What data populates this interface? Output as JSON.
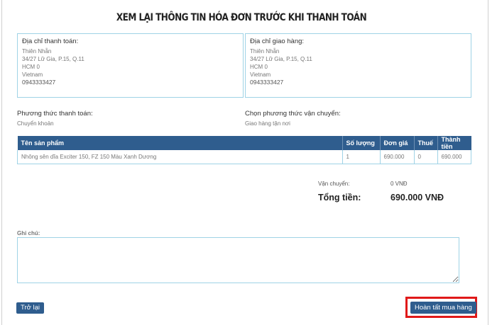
{
  "page": {
    "title": "XEM LẠI THÔNG TIN HÓA ĐƠN TRƯỚC KHI THANH TOÁN",
    "accent_color": "#2f5d8e",
    "border_color": "#9fd3e6",
    "highlight_color": "#e01919"
  },
  "billing_address": {
    "heading": "Địa chỉ thanh toán:",
    "name": "Thiên Nhẫn",
    "street": "34/27 Lữ Gia, P.15, Q.11",
    "city": "HCM 0",
    "country": "Vietnam",
    "phone": "0943333427"
  },
  "shipping_address": {
    "heading": "Địa chỉ giao hàng:",
    "name": "Thiên Nhẫn",
    "street": "34/27 Lữ Gia, P.15, Q.11",
    "city": "HCM 0",
    "country": "Vietnam",
    "phone": "0943333427"
  },
  "payment_method": {
    "label": "Phương thức thanh toán:",
    "value": "Chuyển khoản"
  },
  "shipping_method": {
    "label": "Chọn phương thức vận chuyển:",
    "value": "Giao hàng tận nơi"
  },
  "table": {
    "headers": [
      "Tên sản phẩm",
      "Số lượng",
      "Đơn giá",
      "Thuế",
      "Thành tiền"
    ],
    "rows": [
      {
        "product": "Nhông sên dĩa Exciter 150, FZ 150 Màu Xanh Dương",
        "quantity": "1",
        "unit_price": "690.000",
        "tax": "0",
        "total": "690.000"
      }
    ]
  },
  "totals": {
    "shipping_label": "Vận chuyển:",
    "shipping_value": "0 VNĐ",
    "total_label": "Tổng tiền:",
    "total_value": "690.000 VNĐ"
  },
  "note": {
    "label": "Ghi chú:",
    "value": ""
  },
  "buttons": {
    "back": "Trở lại",
    "finish": "Hoàn tất mua hàng"
  }
}
